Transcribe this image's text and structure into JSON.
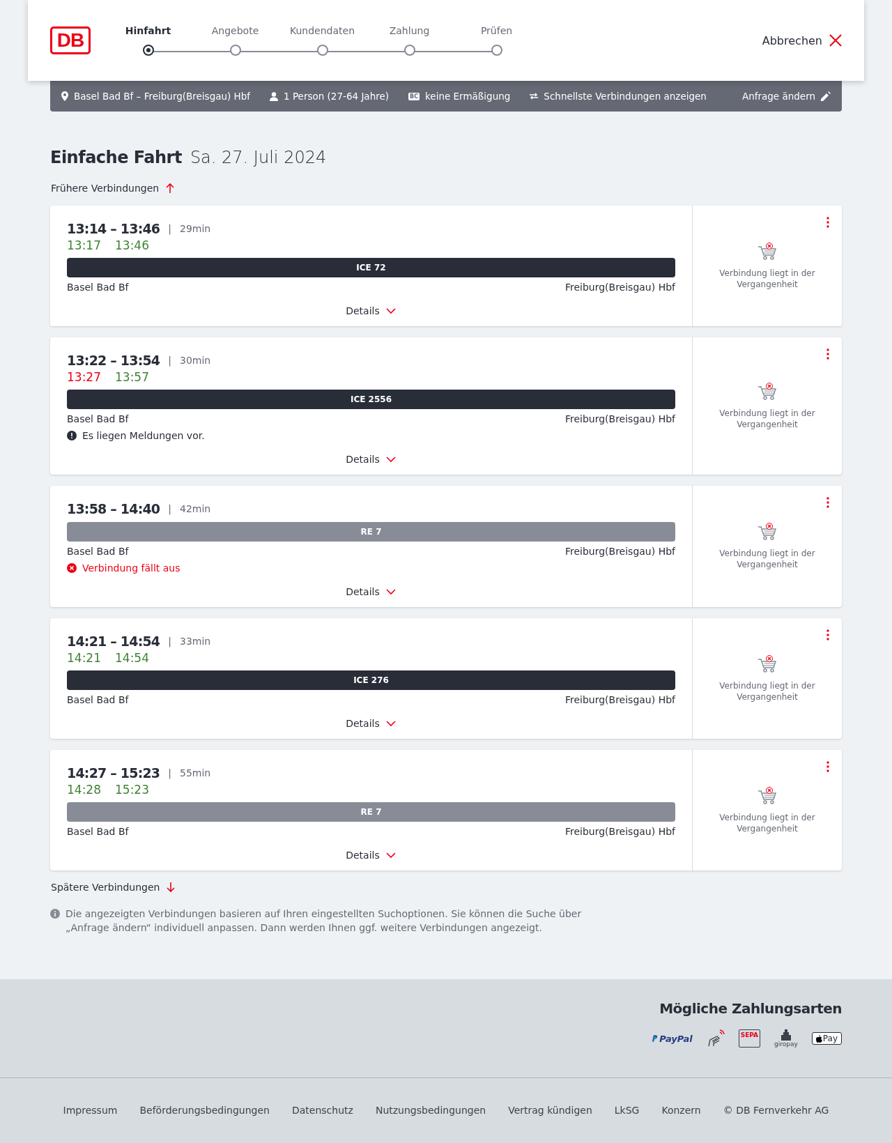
{
  "header": {
    "logo": "DB",
    "steps": [
      {
        "label": "Hinfahrt",
        "selected": true
      },
      {
        "label": "Angebote",
        "selected": false
      },
      {
        "label": "Kundendaten",
        "selected": false
      },
      {
        "label": "Zahlung",
        "selected": false
      },
      {
        "label": "Prüfen",
        "selected": false
      }
    ],
    "cancel": "Abbrechen"
  },
  "summary": {
    "route": "Basel Bad Bf – Freiburg(Breisgau) Hbf",
    "travellers": "1 Person (27-64 Jahre)",
    "discount": "keine Ermäßigung",
    "discount_badge": "BC",
    "option": "Schnellste Verbindungen anzeigen",
    "edit": "Anfrage ändern"
  },
  "title": {
    "main": "Einfache Fahrt",
    "date": "Sa. 27. Juli 2024"
  },
  "earlier": "Frühere Verbindungen",
  "connections": [
    {
      "times": "13:14 – 13:46",
      "separator": "|",
      "duration": "29min",
      "actual": [
        {
          "time": "13:17",
          "delayed": false
        },
        {
          "time": "13:46",
          "delayed": false
        }
      ],
      "train": "ICE 72",
      "kind": "long-distance",
      "from": "Basel Bad Bf",
      "to": "Freiburg(Breisgau) Hbf",
      "details": "Details",
      "status": "Verbindung liegt in der Vergangenheit"
    },
    {
      "times": "13:22 – 13:54",
      "separator": "|",
      "duration": "30min",
      "actual": [
        {
          "time": "13:27",
          "delayed": true
        },
        {
          "time": "13:57",
          "delayed": false
        }
      ],
      "train": "ICE 2556",
      "kind": "long-distance",
      "from": "Basel Bad Bf",
      "to": "Freiburg(Breisgau) Hbf",
      "message": {
        "kind": "notice",
        "text": "Es liegen Meldungen vor."
      },
      "details": "Details",
      "status": "Verbindung liegt in der Vergangenheit"
    },
    {
      "times": "13:58 – 14:40",
      "separator": "|",
      "duration": "42min",
      "train": "RE 7",
      "kind": "regional",
      "from": "Basel Bad Bf",
      "to": "Freiburg(Breisgau) Hbf",
      "message": {
        "kind": "cancelled",
        "text": "Verbindung fällt aus"
      },
      "details": "Details",
      "status": "Verbindung liegt in der Vergangenheit"
    },
    {
      "times": "14:21 – 14:54",
      "separator": "|",
      "duration": "33min",
      "actual": [
        {
          "time": "14:21",
          "delayed": false
        },
        {
          "time": "14:54",
          "delayed": false
        }
      ],
      "train": "ICE 276",
      "kind": "long-distance",
      "from": "Basel Bad Bf",
      "to": "Freiburg(Breisgau) Hbf",
      "details": "Details",
      "status": "Verbindung liegt in der Vergangenheit"
    },
    {
      "times": "14:27 – 15:23",
      "separator": "|",
      "duration": "55min",
      "actual": [
        {
          "time": "14:28",
          "delayed": false
        },
        {
          "time": "15:23",
          "delayed": false
        }
      ],
      "train": "RE 7",
      "kind": "regional",
      "from": "Basel Bad Bf",
      "to": "Freiburg(Breisgau) Hbf",
      "details": "Details",
      "status": "Verbindung liegt in der Vergangenheit"
    }
  ],
  "later": "Spätere Verbindungen",
  "info": "Die angezeigten Verbindungen basieren auf Ihren eingestellten Suchoptionen. Sie können die Suche über „Anfrage ändern“ individuell anpassen. Dann werden Ihnen ggf. weitere Verbindungen angezeigt.",
  "payment": {
    "title": "Mögliche Zahlungsarten",
    "methods": [
      {
        "kind": "paypal",
        "label": "PayPal"
      },
      {
        "kind": "contactless"
      },
      {
        "kind": "sepa",
        "label": "SEPA"
      },
      {
        "kind": "giropay",
        "label": "giropay"
      },
      {
        "kind": "applepay",
        "label": "Pay"
      }
    ]
  },
  "footer": [
    "Impressum",
    "Beförderungsbedingungen",
    "Datenschutz",
    "Nutzungsbedingungen",
    "Vertrag kündigen",
    "LkSG",
    "Konzern",
    "© DB Fernverkehr AG"
  ]
}
